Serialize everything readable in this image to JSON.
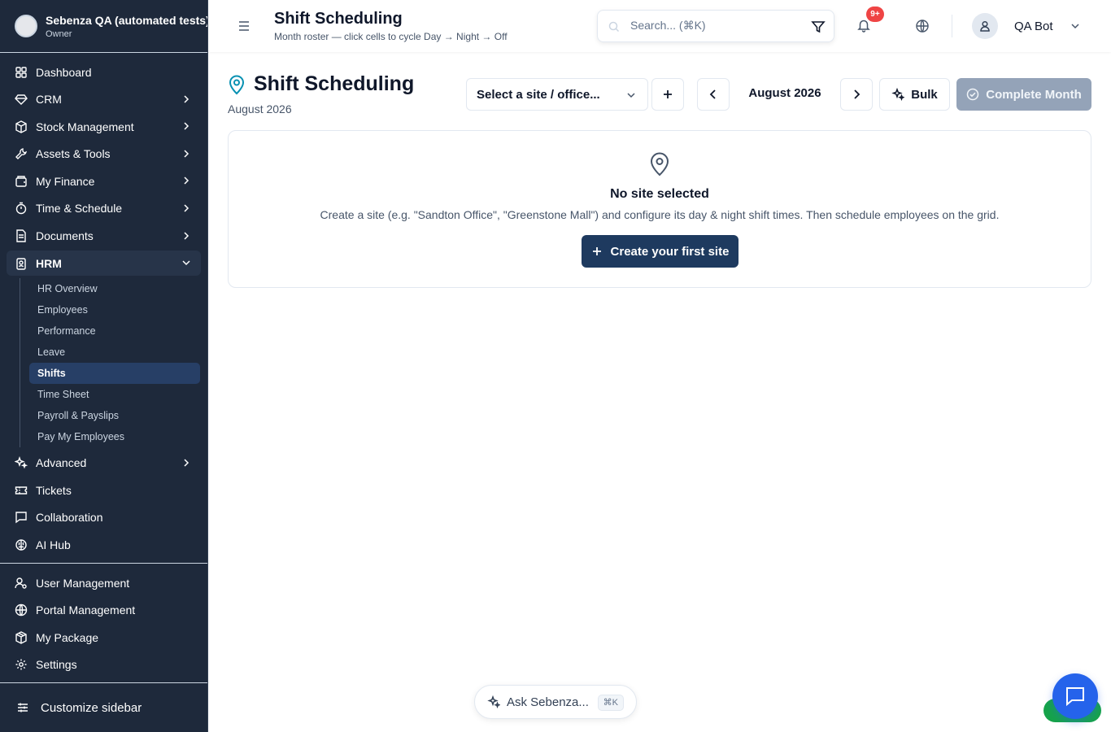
{
  "org": {
    "name": "Sebenza QA (automated tests)",
    "role": "Owner"
  },
  "sidebar": {
    "items": [
      {
        "label": "Dashboard"
      },
      {
        "label": "CRM"
      },
      {
        "label": "Stock Management"
      },
      {
        "label": "Assets & Tools"
      },
      {
        "label": "My Finance"
      },
      {
        "label": "Time & Schedule"
      },
      {
        "label": "Documents"
      },
      {
        "label": "HRM"
      },
      {
        "label": "Advanced"
      },
      {
        "label": "Tickets"
      },
      {
        "label": "Collaboration"
      },
      {
        "label": "AI Hub"
      }
    ],
    "hrm_sub": [
      {
        "label": "HR Overview"
      },
      {
        "label": "Employees"
      },
      {
        "label": "Performance"
      },
      {
        "label": "Leave"
      },
      {
        "label": "Shifts"
      },
      {
        "label": "Time Sheet"
      },
      {
        "label": "Payroll & Payslips"
      },
      {
        "label": "Pay My Employees"
      }
    ],
    "bottom": [
      {
        "label": "User Management"
      },
      {
        "label": "Portal Management"
      },
      {
        "label": "My Package"
      },
      {
        "label": "Settings"
      }
    ],
    "customize_label": "Customize sidebar"
  },
  "header": {
    "title": "Shift Scheduling",
    "subtitle": "Month roster — click cells to cycle Day → Night → Off",
    "search_placeholder": "Search... (⌘K)",
    "notification_badge": "9+",
    "user_name": "QA Bot"
  },
  "main": {
    "title": "Shift Scheduling",
    "subtitle": "August 2026",
    "site_select_label": "Select a site / office...",
    "month_label": "August 2026",
    "bulk_label": "Bulk",
    "complete_label": "Complete Month",
    "empty_title": "No site selected",
    "empty_desc": "Create a site (e.g. \"Sandton Office\", \"Greenstone Mall\") and configure its day & night shift times. Then schedule employees on the grid.",
    "create_label": "Create your first site"
  },
  "assistant": {
    "label": "Ask Sebenza...",
    "shortcut": "⌘K"
  },
  "colors": {
    "sidebar_bg": "#1e293b",
    "primary": "#1e3a5f",
    "accent_pin": "#0891b2",
    "badge": "#ef4444",
    "chat": "#2563eb"
  }
}
